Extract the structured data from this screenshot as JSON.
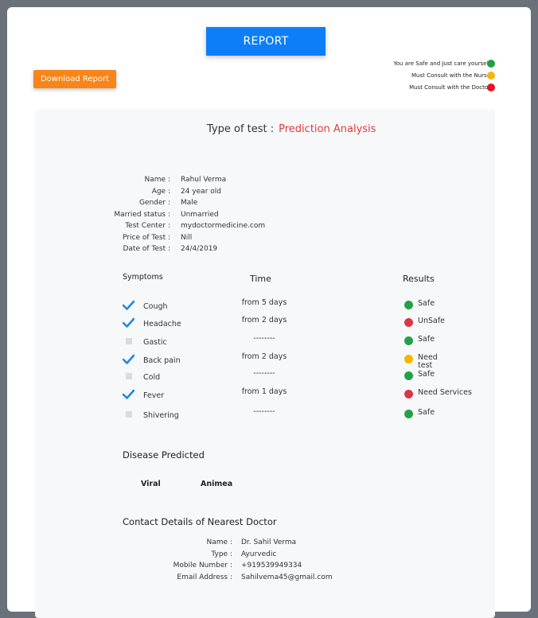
{
  "header": {
    "report_label": "REPORT",
    "download_label": "Download Report"
  },
  "legend": [
    {
      "text": "You are Safe and Just care yourself",
      "color": "#24a148"
    },
    {
      "text": "Must Consult with the Nurse",
      "color": "#f7b500"
    },
    {
      "text": "Must Consult with the Doctor",
      "color": "#e8102a"
    }
  ],
  "test": {
    "label": "Type of test :",
    "value": "Prediction Analysis"
  },
  "patient": [
    {
      "label": "Name :",
      "value": "Rahul Verma"
    },
    {
      "label": "Age :",
      "value": "24 year old"
    },
    {
      "label": "Gender :",
      "value": "Male"
    },
    {
      "label": "Married status :",
      "value": "Unmarried"
    },
    {
      "label": "Test Center :",
      "value": "mydoctormedicine.com"
    },
    {
      "label": "Price of Test :",
      "value": "Nill"
    },
    {
      "label": "Date of Test :",
      "value": "24/4/2019"
    }
  ],
  "columns": {
    "symptoms": "Symptoms",
    "time": "Time",
    "results": "Results"
  },
  "symptoms": [
    {
      "name": "Cough",
      "checked": true,
      "time": "from 5 days",
      "result": "Safe",
      "status": "green"
    },
    {
      "name": "Headache",
      "checked": true,
      "time": "from 2 days",
      "result": "UnSafe",
      "status": "red"
    },
    {
      "name": "Gastic",
      "checked": false,
      "time": "--------",
      "result": "Safe",
      "status": "green"
    },
    {
      "name": "Back pain",
      "checked": true,
      "time": "from 2 days",
      "result": "Need test",
      "status": "yellow"
    },
    {
      "name": "Cold",
      "checked": false,
      "time": "--------",
      "result": "Safe",
      "status": "green"
    },
    {
      "name": "Fever",
      "checked": true,
      "time": "from 1 days",
      "result": "Need Services",
      "status": "red"
    },
    {
      "name": "Shivering",
      "checked": false,
      "time": "--------",
      "result": "Safe",
      "status": "green"
    }
  ],
  "disease": {
    "title": "Disease Predicted",
    "items": [
      "Viral",
      "Animea"
    ]
  },
  "contact": {
    "title": "Contact Details of Nearest Doctor",
    "rows": [
      {
        "label": "Name :",
        "value": "Dr. Sahil Verma"
      },
      {
        "label": "Type  :",
        "value": "Ayurvedic"
      },
      {
        "label": "Mobile Number :",
        "value": "+919539949334"
      },
      {
        "label": "Email Address :",
        "value": "Sahilvema45@gmail.com"
      }
    ]
  },
  "icons": {
    "checked": "checkmark-icon",
    "unchecked": "empty-checkbox-icon",
    "status": "status-dot-icon"
  }
}
